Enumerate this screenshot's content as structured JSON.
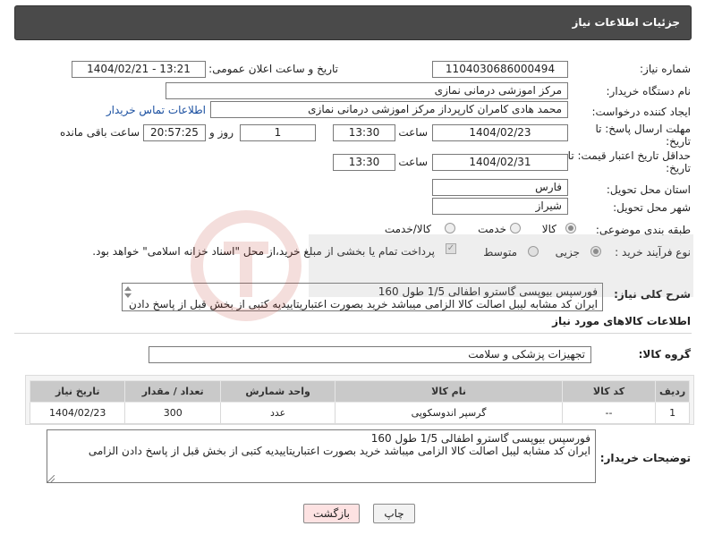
{
  "header": {
    "title": "جزئیات اطلاعات نیاز"
  },
  "fields": {
    "need_number_label": "شماره نیاز:",
    "need_number": "1104030686000494",
    "announce_label": "تاریخ و ساعت اعلان عمومی:",
    "announce_value": "1404/02/21 - 13:21",
    "buyer_label": "نام دستگاه خریدار:",
    "buyer_value": "مرکز اموزشی درمانی نمازی",
    "creator_label": "ایجاد کننده درخواست:",
    "creator_value": "محمد هادی کامران کارپرداز مرکز اموزشی درمانی نمازی",
    "contact_link": "اطلاعات تماس خریدار",
    "deadline_label": "مهلت ارسال پاسخ: تا تاریخ:",
    "deadline_date": "1404/02/23",
    "time_label": "ساعت",
    "deadline_time": "13:30",
    "days_value": "1",
    "days_label": "روز و",
    "remaining_time": "20:57:25",
    "remaining_label": "ساعت باقی مانده",
    "validity_label": "حداقل تاریخ اعتبار قیمت: تا تاریخ:",
    "validity_date": "1404/02/31",
    "validity_time": "13:30",
    "province_label": "استان محل تحویل:",
    "province_value": "فارس",
    "city_label": "شهر محل تحویل:",
    "city_value": "شیراز",
    "category_label": "طبقه بندی موضوعی:",
    "category_options": [
      "کالا",
      "خدمت",
      "کالا/خدمت"
    ],
    "process_label": "نوع فرآیند خرید :",
    "process_options": [
      "جزیی",
      "متوسط"
    ],
    "payment_note": "پرداخت تمام یا بخشی از مبلغ خرید،از محل \"اسناد خزانه اسلامی\" خواهد بود.",
    "summary_label": "شرح کلی نیاز:",
    "summary_line1": "فورسپس بیوپسی گاسترو اطفالی 1/5  طول 160",
    "summary_line2": "ایران کد مشابه لیبل اصالت کالا الزامی میباشد خرید بصورت اعتباریتاییدیه کتبی از بخش قبل از پاسخ دادن",
    "goods_info_title": "اطلاعات کالاهای مورد نیاز",
    "goods_group_label": "گروه کالا:",
    "goods_group_value": "تجهیزات پزشکی و سلامت"
  },
  "table": {
    "headers": [
      "ردیف",
      "کد کالا",
      "نام کالا",
      "واحد شمارش",
      "تعداد / مقدار",
      "تاریخ نیاز"
    ],
    "rows": [
      [
        "1",
        "--",
        "گرسپر اندوسکوپی",
        "عدد",
        "300",
        "1404/02/23"
      ]
    ]
  },
  "buyer_notes": {
    "label": "توضیحات خریدار:",
    "line1": "فورسپس بیوپسی گاسترو اطفالی 1/5  طول 160",
    "line2": "ایران کد مشابه لیبل اصالت کالا الزامی میباشد خرید بصورت اعتباریتاییدیه کتبی از بخش قبل از پاسخ دادن الزامی"
  },
  "buttons": {
    "print": "چاپ",
    "back": "بازگشت"
  },
  "colors": {
    "header_bg": "#4a4a4a",
    "link": "#1a4fa0",
    "back_btn_bg": "#fde2e2",
    "table_header_bg": "#c9c9c9"
  }
}
